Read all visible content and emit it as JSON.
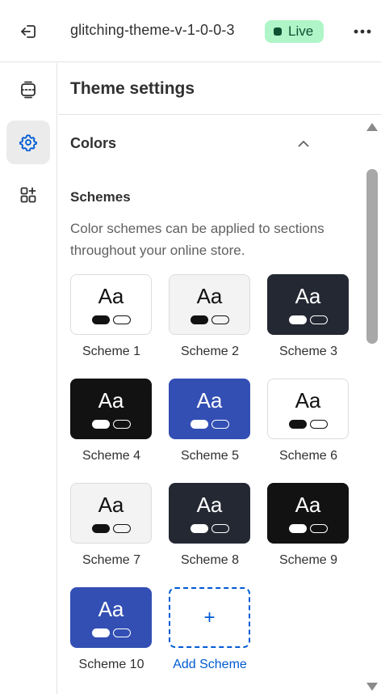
{
  "topbar": {
    "theme_name": "glitching-theme-v-1-0-0-3",
    "status_badge": "Live",
    "icons": {
      "exit": "exit-icon",
      "more": "more-horizontal-icon"
    }
  },
  "siderail": {
    "items": [
      {
        "icon": "sections-icon",
        "active": false
      },
      {
        "icon": "settings-gear-icon",
        "active": true
      },
      {
        "icon": "apps-add-icon",
        "active": false
      }
    ]
  },
  "panel": {
    "title": "Theme settings",
    "section": {
      "title": "Colors",
      "expanded": true,
      "subtitle": "Schemes",
      "description": "Color schemes can be applied to sections throughout your online store."
    }
  },
  "schemes": [
    {
      "label": "Scheme 1",
      "sample": "Aa",
      "bg": "#ffffff",
      "text": "#121212",
      "primary": "#121212",
      "secondary": "#121212"
    },
    {
      "label": "Scheme 2",
      "sample": "Aa",
      "bg": "#f3f3f3",
      "text": "#121212",
      "primary": "#121212",
      "secondary": "#121212"
    },
    {
      "label": "Scheme 3",
      "sample": "Aa",
      "bg": "#242833",
      "text": "#ffffff",
      "primary": "#ffffff",
      "secondary": "#ffffff"
    },
    {
      "label": "Scheme 4",
      "sample": "Aa",
      "bg": "#121212",
      "text": "#ffffff",
      "primary": "#ffffff",
      "secondary": "#ffffff"
    },
    {
      "label": "Scheme 5",
      "sample": "Aa",
      "bg": "#334fb4",
      "text": "#ffffff",
      "primary": "#ffffff",
      "secondary": "#ffffff"
    },
    {
      "label": "Scheme 6",
      "sample": "Aa",
      "bg": "#ffffff",
      "text": "#121212",
      "primary": "#121212",
      "secondary": "#121212"
    },
    {
      "label": "Scheme 7",
      "sample": "Aa",
      "bg": "#f3f3f3",
      "text": "#121212",
      "primary": "#121212",
      "secondary": "#121212"
    },
    {
      "label": "Scheme 8",
      "sample": "Aa",
      "bg": "#242833",
      "text": "#ffffff",
      "primary": "#ffffff",
      "secondary": "#ffffff"
    },
    {
      "label": "Scheme 9",
      "sample": "Aa",
      "bg": "#121212",
      "text": "#ffffff",
      "primary": "#ffffff",
      "secondary": "#ffffff"
    },
    {
      "label": "Scheme 10",
      "sample": "Aa",
      "bg": "#334fb4",
      "text": "#ffffff",
      "primary": "#ffffff",
      "secondary": "#ffffff"
    }
  ],
  "add_scheme": {
    "label": "Add Scheme",
    "plus": "+"
  },
  "colors": {
    "accent": "#005bd3",
    "live_bg": "#aff5c8",
    "live_text": "#0c5132"
  }
}
